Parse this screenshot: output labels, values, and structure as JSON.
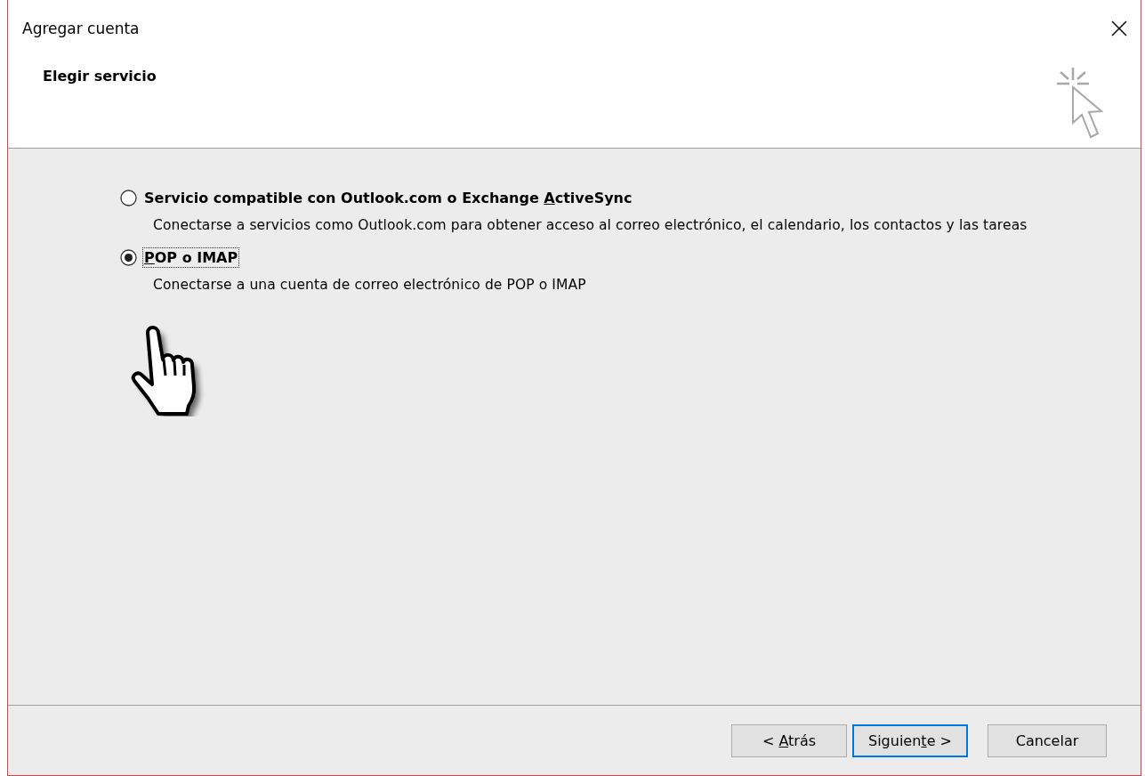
{
  "window": {
    "title": "Agregar cuenta"
  },
  "header": {
    "title": "Elegir servicio"
  },
  "options": [
    {
      "label": {
        "before": "Servicio compatible con Outlook.com o Exchange ",
        "key": "A",
        "after": "ctiveSync"
      },
      "description": "Conectarse a servicios como Outlook.com para obtener acceso al correo electrónico, el calendario, los contactos y las tareas",
      "selected": false
    },
    {
      "label": {
        "key": "P",
        "after": "OP o IMAP"
      },
      "description": "Conectarse a una cuenta de correo electrónico de POP o IMAP",
      "selected": true
    }
  ],
  "buttons": [
    {
      "label": {
        "before": "< ",
        "key": "A",
        "after": "trás"
      },
      "default": false
    },
    {
      "label": {
        "before": "Siguien",
        "key": "t",
        "after": "e >"
      },
      "default": true
    },
    {
      "label": {
        "after": "Cancelar"
      },
      "default": false
    }
  ]
}
